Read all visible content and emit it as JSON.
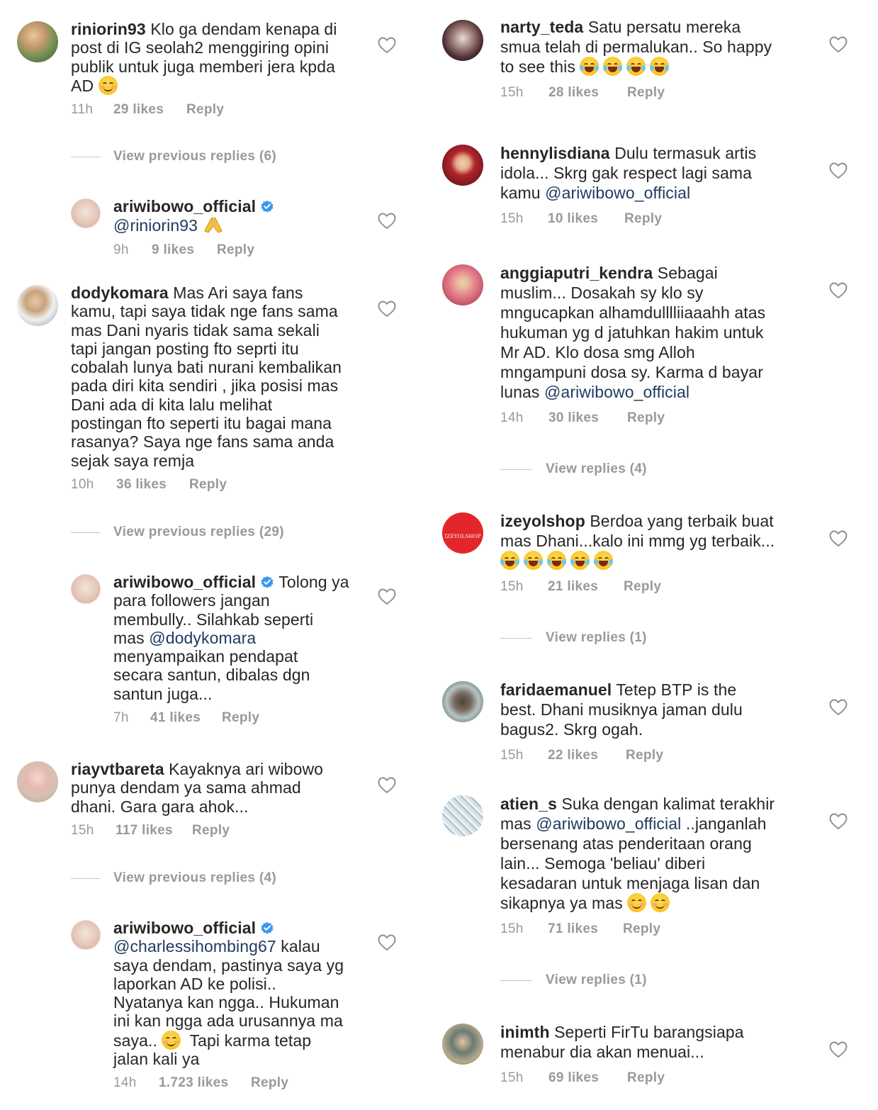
{
  "left": {
    "c1": {
      "user": "riniorin93",
      "text1": "Klo ga dendam kenapa di",
      "line2": "post di IG seolah2 menggiring opini",
      "line3": "publik untuk juga memberi jera kpda",
      "line4": "AD",
      "time": "11h",
      "likes": "29 likes",
      "reply": "Reply"
    },
    "v1": {
      "label": "View previous replies (6)"
    },
    "r1": {
      "user": "ariwibowo_official",
      "mention": "@riniorin93",
      "time": "9h",
      "likes": "9 likes",
      "reply": "Reply"
    },
    "c2": {
      "user": "dodykomara",
      "text1": "Mas Ari saya fans",
      "lines": [
        "kamu, tapi saya tidak nge fans sama",
        "mas Dani nyaris tidak sama sekali",
        "tapi jangan posting fto seprti itu",
        "cobalah lunya bati nurani kembalikan",
        "pada diri kita sendiri , jika posisi mas",
        "Dani ada di kita lalu melihat",
        "postingan fto seperti itu bagai mana",
        "rasanya? Saya nge fans sama anda",
        "sejak saya remja"
      ],
      "time": "10h",
      "likes": "36 likes",
      "reply": "Reply"
    },
    "v2": {
      "label": "View previous replies (29)"
    },
    "r2": {
      "user": "ariwibowo_official",
      "text1": "Tolong ya",
      "line2": "para followers jangan",
      "line3": "membully.. Silahkab seperti",
      "line4a": "mas ",
      "mention": "@dodykomara",
      "line5": "menyampaikan pendapat",
      "line6": "secara santun, dibalas dgn",
      "line7": "santun juga...",
      "time": "7h",
      "likes": "41 likes",
      "reply": "Reply"
    },
    "c3": {
      "user": "riayvtbareta",
      "text1": "Kayaknya ari wibowo",
      "line2": "punya dendam ya  sama ahmad",
      "line3": "dhani. Gara gara ahok...",
      "time": "15h",
      "likes": "117 likes",
      "reply": "Reply"
    },
    "v3": {
      "label": "View previous replies (4)"
    },
    "r3": {
      "user": "ariwibowo_official",
      "mention": "@charlessihombing67",
      "text1": " kalau",
      "line2": "saya dendam, pastinya saya yg",
      "line3": "laporkan AD ke polisi..",
      "line4": "Nyatanya kan ngga.. Hukuman",
      "line5": "ini kan ngga ada urusannya ma",
      "line6a": "saya.. ",
      "line6b": " Tapi karma tetap",
      "line7": "jalan kali ya",
      "time": "14h",
      "likes": "1.723 likes",
      "reply": "Reply"
    }
  },
  "right": {
    "c1": {
      "user": "narty_teda",
      "text1": "Satu persatu mereka",
      "line2": "smua telah di permalukan.. So happy",
      "line3": "to see this",
      "time": "15h",
      "likes": "28 likes",
      "reply": "Reply"
    },
    "c2": {
      "user": "hennylisdiana",
      "text1": "Dulu termasuk artis",
      "line2": "idola... Skrg gak respect lagi sama",
      "line3a": "kamu ",
      "mention": "@ariwibowo_official",
      "time": "15h",
      "likes": "10 likes",
      "reply": "Reply"
    },
    "c3": {
      "user": "anggiaputri_kendra",
      "text1": "Sebagai",
      "lines": [
        "muslim... Dosakah sy klo sy",
        "mngucapkan alhamdulllliiaaahh atas",
        "hukuman yg d jatuhkan hakim untuk",
        "Mr AD. Klo dosa smg Alloh",
        "mngampuni dosa sy. Karma d bayar"
      ],
      "line7a": "lunas ",
      "mention": "@ariwibowo_official",
      "time": "14h",
      "likes": "30 likes",
      "reply": "Reply"
    },
    "v1": {
      "label": "View replies (4)"
    },
    "c4": {
      "user": "izeyolshop",
      "text1": "Berdoa yang terbaik buat",
      "line2": "mas Dhani...kalo ini mmg yg terbaik...",
      "avatar_text": "IZEYOLSHOP",
      "time": "15h",
      "likes": "21 likes",
      "reply": "Reply"
    },
    "v2": {
      "label": "View replies (1)"
    },
    "c5": {
      "user": "faridaemanuel",
      "text1": "Tetep BTP is the",
      "line2": "best. Dhani musiknya jaman dulu",
      "line3": "bagus2. Skrg ogah.",
      "time": "15h",
      "likes": "22 likes",
      "reply": "Reply"
    },
    "c6": {
      "user": "atien_s",
      "text1": "Suka dengan kalimat terakhir",
      "line2a": "mas ",
      "mention": "@ariwibowo_official",
      "line2b": " ..janganlah",
      "line3": "bersenang atas penderitaan orang",
      "line4": "lain... Semoga 'beliau' diberi",
      "line5": "kesadaran untuk menjaga lisan dan",
      "line6": "sikapnya ya mas",
      "time": "15h",
      "likes": "71 likes",
      "reply": "Reply"
    },
    "v3": {
      "label": "View replies (1)"
    },
    "c7": {
      "user": "inimth",
      "text1": "Seperti FirTu barangsiapa",
      "line2": "menabur dia akan menuai...",
      "time": "15h",
      "likes": "69 likes",
      "reply": "Reply"
    }
  },
  "colors": {
    "text": "#262626",
    "meta": "#999999",
    "mention": "#1e3a5f",
    "verified": "#3897f0",
    "heart": "#8e8e8e",
    "avatar_izeyol": "#e3262b"
  }
}
